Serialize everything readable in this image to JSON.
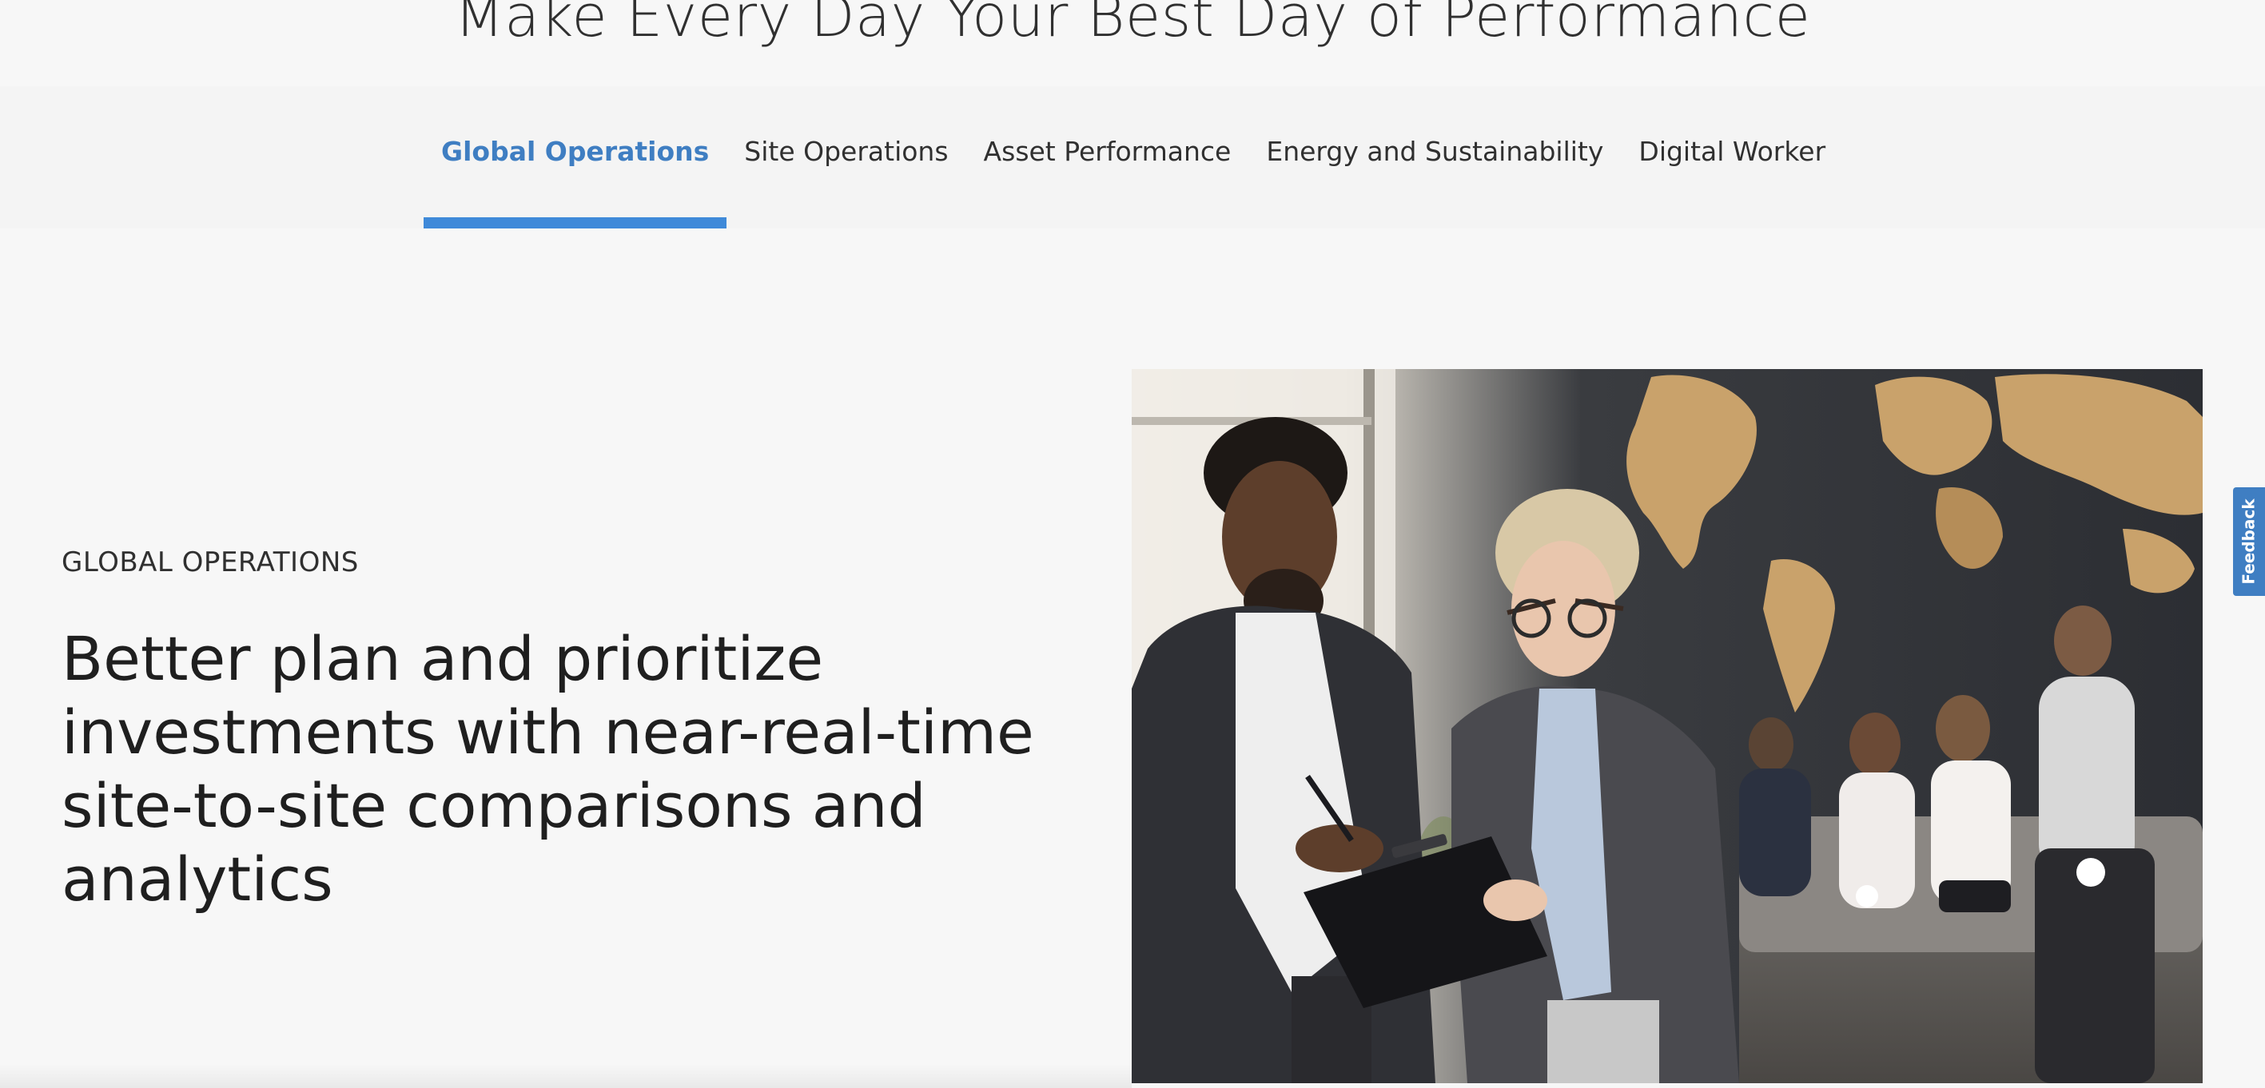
{
  "hero": {
    "heading": "Make Every Day Your Best Day of Performance"
  },
  "tabs": [
    {
      "label": "Global Operations",
      "active": true
    },
    {
      "label": "Site Operations",
      "active": false
    },
    {
      "label": "Asset Performance",
      "active": false
    },
    {
      "label": "Energy and Sustainability",
      "active": false
    },
    {
      "label": "Digital Worker",
      "active": false
    }
  ],
  "section": {
    "kicker": "GLOBAL OPERATIONS",
    "heading": "Better plan and prioritize investments with near-real-time site-to-site comparisons and analytics",
    "image": "business-team-meeting-photo"
  },
  "feedback": {
    "label": "Feedback"
  },
  "colors": {
    "accent": "#3f7ec2",
    "tab_indicator": "#3f8ad9",
    "background": "#f7f7f7",
    "text": "#303030"
  }
}
